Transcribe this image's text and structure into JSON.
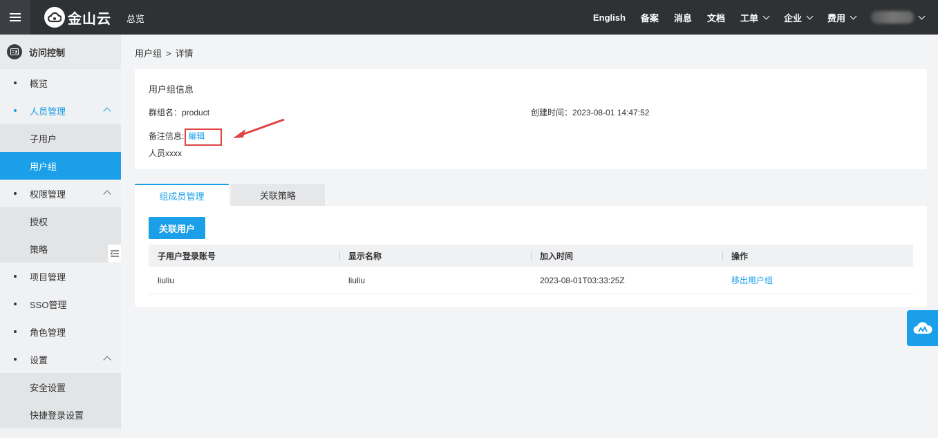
{
  "topbar": {
    "logo_text": "金山云",
    "overview": "总览",
    "items": [
      {
        "label": "English",
        "dropdown": false
      },
      {
        "label": "备案",
        "dropdown": false
      },
      {
        "label": "消息",
        "dropdown": false
      },
      {
        "label": "文档",
        "dropdown": false
      },
      {
        "label": "工单",
        "dropdown": true
      },
      {
        "label": "企业",
        "dropdown": true
      },
      {
        "label": "费用",
        "dropdown": true
      }
    ]
  },
  "sidebar": {
    "title": "访问控制",
    "overview": "概览",
    "people_mgmt": "人员管理",
    "sub_user": "子用户",
    "user_group": "用户组",
    "perm_mgmt": "权限管理",
    "authorize": "授权",
    "policy": "策略",
    "project_mgmt": "项目管理",
    "sso_mgmt": "SSO管理",
    "role_mgmt": "角色管理",
    "settings": "设置",
    "security_settings": "安全设置",
    "quick_login_settings": "快捷登录设置"
  },
  "breadcrumb": {
    "parent": "用户组",
    "sep": ">",
    "current": "详情"
  },
  "info": {
    "title": "用户组信息",
    "group_name_label": "群组名：",
    "group_name": "product",
    "created_label": "创建时间：",
    "created_value": "2023-08-01 14:47:52",
    "remark_label": "备注信息:",
    "edit_label": "编辑",
    "remark_value": "人员xxxx"
  },
  "tabs": {
    "members": "组成员管理",
    "policies": "关联策略"
  },
  "members": {
    "associate_button": "关联用户",
    "columns": [
      "子用户登录账号",
      "显示名称",
      "加入时间",
      "操作"
    ],
    "rows": [
      {
        "account": "liuliu",
        "display_name": "liuliu",
        "joined": "2023-08-01T03:33:25Z",
        "action": "移出用户组"
      }
    ]
  },
  "colors": {
    "accent": "#1a9fe8",
    "topbar": "#2f3235",
    "highlight": "#e04343"
  }
}
